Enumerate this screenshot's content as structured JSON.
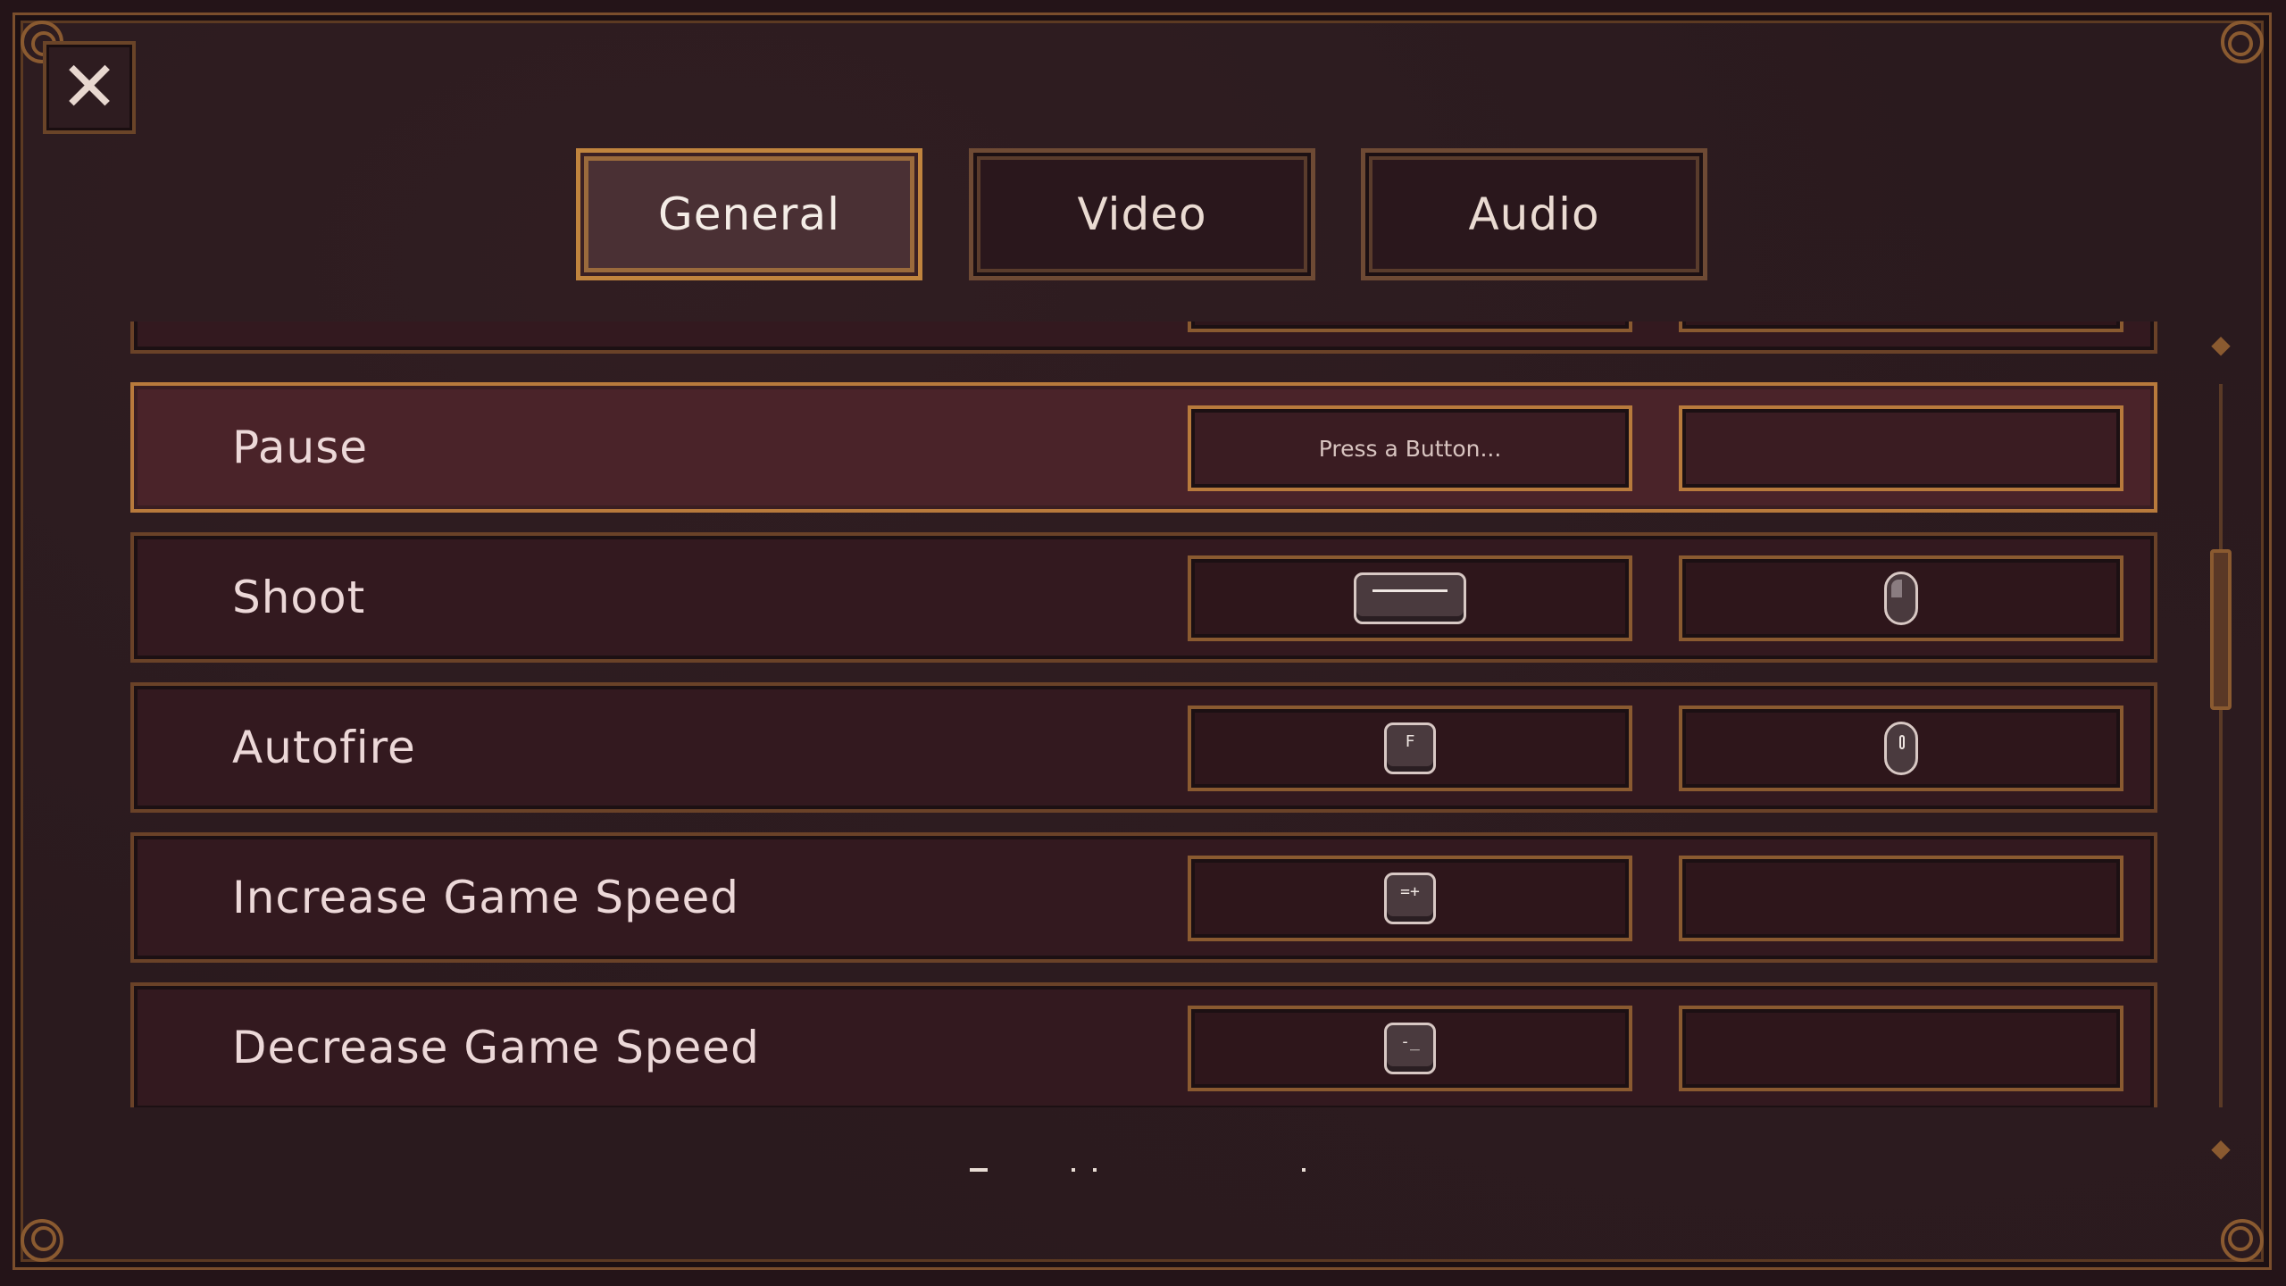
{
  "close_button": {
    "symbol": "✕"
  },
  "tabs": [
    {
      "label": "General",
      "active": true
    },
    {
      "label": "Video",
      "active": false
    },
    {
      "label": "Audio",
      "active": false
    }
  ],
  "bindings": [
    {
      "action": "Pause",
      "selected": true,
      "primary_text": "Press a Button..."
    },
    {
      "action": "Shoot",
      "primary_key": "space-key",
      "secondary_key": "left-mouse-button"
    },
    {
      "action": "Autofire",
      "primary_key": "F",
      "secondary_key": "middle-mouse-button"
    },
    {
      "action": "Increase Game Speed",
      "primary_key": "=+"
    },
    {
      "action": "Decrease Game Speed",
      "primary_key": "-_"
    }
  ],
  "colors": {
    "accent_gold": "#b87a3c",
    "panel_bg": "#2a1a1e",
    "row_bg": "#33191f",
    "selected_row_bg": "#4a2329",
    "text": "#ecd8d8"
  }
}
